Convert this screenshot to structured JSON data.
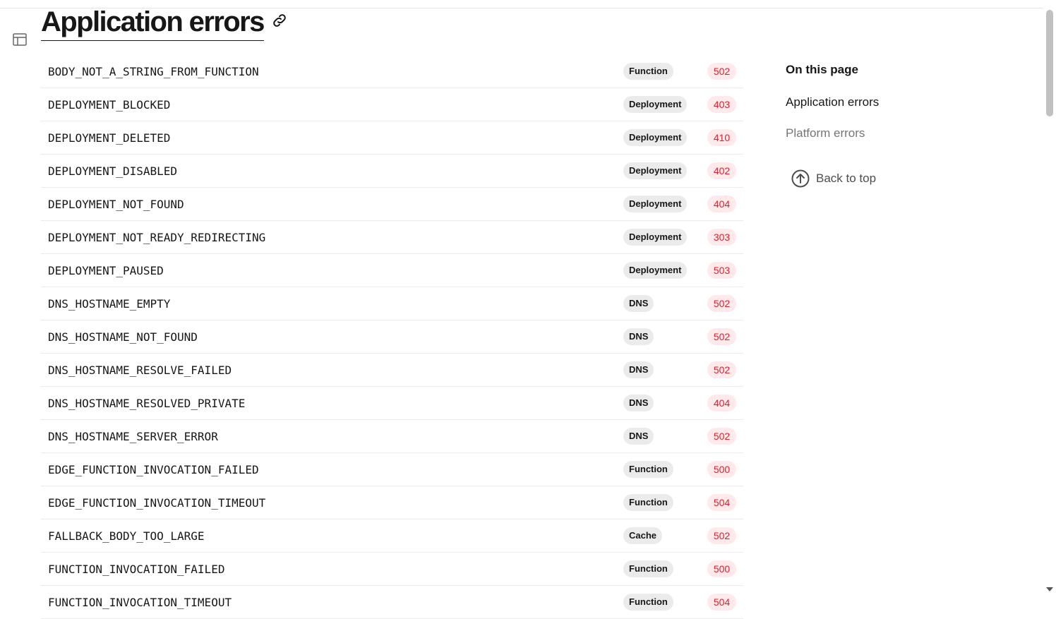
{
  "page": {
    "title": "Application errors"
  },
  "errors": [
    {
      "code": "BODY_NOT_A_STRING_FROM_FUNCTION",
      "category": "Function",
      "status": "502"
    },
    {
      "code": "DEPLOYMENT_BLOCKED",
      "category": "Deployment",
      "status": "403"
    },
    {
      "code": "DEPLOYMENT_DELETED",
      "category": "Deployment",
      "status": "410"
    },
    {
      "code": "DEPLOYMENT_DISABLED",
      "category": "Deployment",
      "status": "402"
    },
    {
      "code": "DEPLOYMENT_NOT_FOUND",
      "category": "Deployment",
      "status": "404"
    },
    {
      "code": "DEPLOYMENT_NOT_READY_REDIRECTING",
      "category": "Deployment",
      "status": "303"
    },
    {
      "code": "DEPLOYMENT_PAUSED",
      "category": "Deployment",
      "status": "503"
    },
    {
      "code": "DNS_HOSTNAME_EMPTY",
      "category": "DNS",
      "status": "502"
    },
    {
      "code": "DNS_HOSTNAME_NOT_FOUND",
      "category": "DNS",
      "status": "502"
    },
    {
      "code": "DNS_HOSTNAME_RESOLVE_FAILED",
      "category": "DNS",
      "status": "502"
    },
    {
      "code": "DNS_HOSTNAME_RESOLVED_PRIVATE",
      "category": "DNS",
      "status": "404"
    },
    {
      "code": "DNS_HOSTNAME_SERVER_ERROR",
      "category": "DNS",
      "status": "502"
    },
    {
      "code": "EDGE_FUNCTION_INVOCATION_FAILED",
      "category": "Function",
      "status": "500"
    },
    {
      "code": "EDGE_FUNCTION_INVOCATION_TIMEOUT",
      "category": "Function",
      "status": "504"
    },
    {
      "code": "FALLBACK_BODY_TOO_LARGE",
      "category": "Cache",
      "status": "502"
    },
    {
      "code": "FUNCTION_INVOCATION_FAILED",
      "category": "Function",
      "status": "500"
    },
    {
      "code": "FUNCTION_INVOCATION_TIMEOUT",
      "category": "Function",
      "status": "504"
    }
  ],
  "toc": {
    "heading": "On this page",
    "items": [
      "Application errors",
      "Platform errors"
    ],
    "back_to_top": "Back to top"
  },
  "icons": {
    "sidebar_toggle": "sidebar-layout-icon",
    "anchor": "link-icon",
    "back_to_top": "arrow-up-circle-icon"
  },
  "colors": {
    "status_text": "#d8232f",
    "status_bg": "#ffe9ea",
    "category_bg": "#ebebeb"
  }
}
